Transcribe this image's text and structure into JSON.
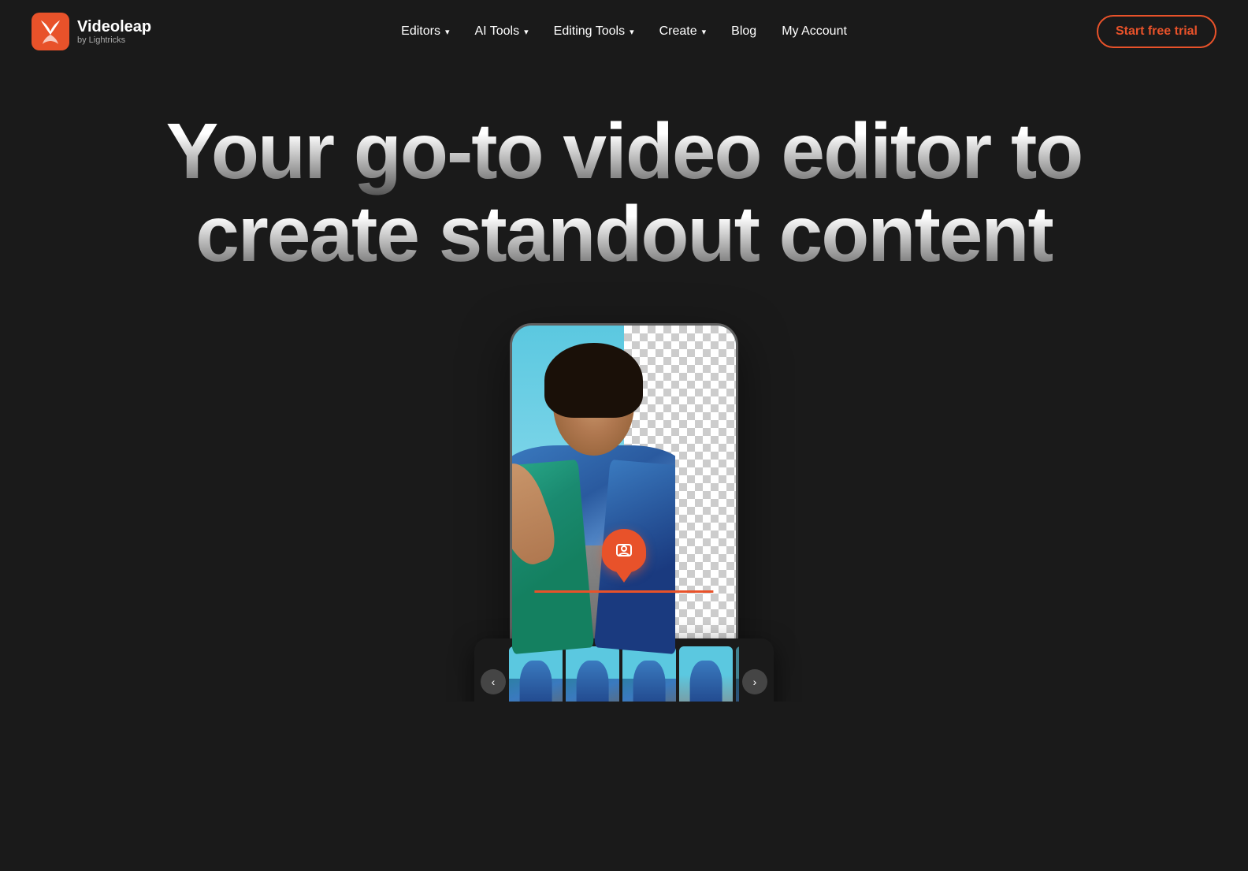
{
  "brand": {
    "name": "Videoleap",
    "tagline": "by Lightricks",
    "logo_alt": "Videoleap logo"
  },
  "nav": {
    "links": [
      {
        "id": "editors",
        "label": "Editors",
        "has_dropdown": true
      },
      {
        "id": "ai-tools",
        "label": "AI Tools",
        "has_dropdown": true
      },
      {
        "id": "editing-tools",
        "label": "Editing Tools",
        "has_dropdown": true
      },
      {
        "id": "create",
        "label": "Create",
        "has_dropdown": true
      },
      {
        "id": "blog",
        "label": "Blog",
        "has_dropdown": false
      },
      {
        "id": "my-account",
        "label": "My Account",
        "has_dropdown": false
      }
    ],
    "cta_label": "Start free trial"
  },
  "hero": {
    "headline_line1": "Your go-to video editor to",
    "headline_line2": "create standout content"
  },
  "filmstrip": {
    "prev_label": "‹",
    "next_label": "›"
  }
}
